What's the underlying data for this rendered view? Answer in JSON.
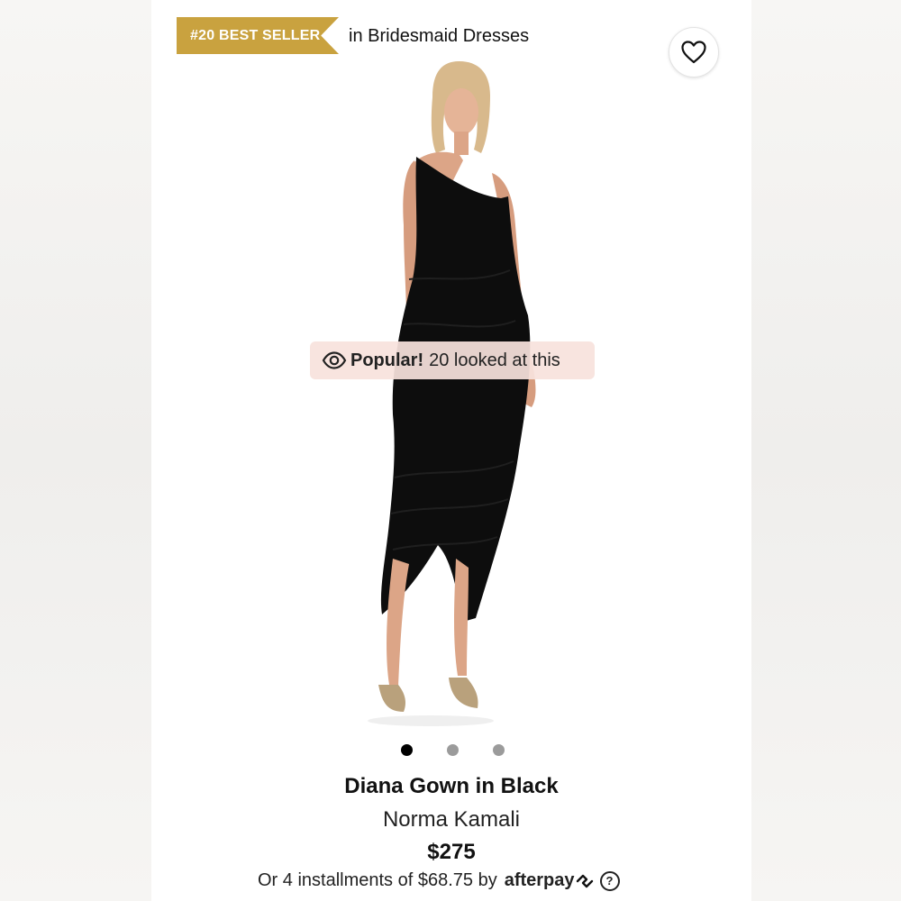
{
  "ribbon": {
    "label": "#20 BEST SELLER",
    "caption": "in Bridesmaid Dresses",
    "color": "#c9a23f"
  },
  "wishlist": {
    "icon": "heart-icon"
  },
  "popular_badge": {
    "icon": "eye-icon",
    "strong": "Popular!",
    "text": "20 looked at this"
  },
  "carousel": {
    "count": 3,
    "active_index": 0
  },
  "product": {
    "name": "Diana Gown in Black",
    "brand": "Norma Kamali",
    "price": "$275",
    "installments_text": "Or 4 installments of $68.75 by",
    "afterpay_label": "afterpay",
    "help_icon": "question-circle-icon",
    "help_glyph": "?"
  }
}
